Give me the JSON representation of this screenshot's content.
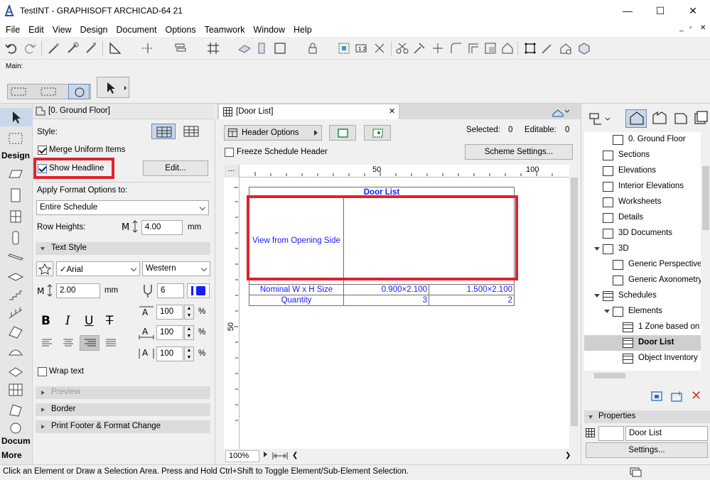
{
  "window": {
    "title": "TestINT - GRAPHISOFT ARCHICAD-64 21",
    "minimize": "—",
    "maximize": "☐",
    "close": "✕"
  },
  "menubar": [
    "File",
    "Edit",
    "View",
    "Design",
    "Document",
    "Options",
    "Teamwork",
    "Window",
    "Help"
  ],
  "mainbar": {
    "label": "Main:"
  },
  "toolbox": {
    "design_tab": "Design",
    "document_tab": "Docum",
    "more_tab": "More"
  },
  "infobox": {
    "header": "[0. Ground Floor]",
    "style_label": "Style:",
    "merge_uniform": "Merge Uniform Items",
    "merge_checked": true,
    "show_headline": "Show Headline",
    "show_headline_checked": true,
    "edit_button": "Edit...",
    "apply_format_label": "Apply Format Options to:",
    "apply_format_value": "Entire Schedule",
    "row_heights_label": "Row Heights:",
    "row_height_value": "4.00",
    "row_height_unit": "mm",
    "text_style_section": "Text Style",
    "font_value": "✓Arial",
    "script_value": "Western",
    "font_size_value": "2.00",
    "font_size_unit": "mm",
    "pen_value": "6",
    "bold": "B",
    "italic": "I",
    "underline": "U",
    "strike": "T",
    "scale1_value": "100",
    "scale2_value": "100",
    "scale3_value": "100",
    "percent": "%",
    "wrap_text": "Wrap text",
    "wrap_checked": false,
    "preview_section": "Preview",
    "border_section": "Border",
    "print_footer_section": "Print Footer & Format Change"
  },
  "document": {
    "tab_title": "[Door List]",
    "header_options": "Header Options",
    "freeze_header": "Freeze Schedule Header",
    "freeze_checked": false,
    "selected_label": "Selected:",
    "selected_value": "0",
    "editable_label": "Editable:",
    "editable_value": "0",
    "scheme_settings": "Scheme Settings...",
    "ruler_marks": [
      "50",
      "100"
    ],
    "ruler_more": "...",
    "vruler_mark": "50",
    "zoom": "100%",
    "schedule": {
      "title": "Door List",
      "headline_row_label": "View from Opening Side",
      "rows": [
        {
          "label": "Nominal W x H Size",
          "values": [
            "0.900×2.100",
            "1.500×2.100"
          ]
        },
        {
          "label": "Quantity",
          "values": [
            "3",
            "2"
          ]
        }
      ]
    }
  },
  "navigator": {
    "items": [
      {
        "label": "0. Ground Floor",
        "indent": 1,
        "icon": "story-icon"
      },
      {
        "label": "Sections",
        "indent": 0,
        "icon": "section-icon"
      },
      {
        "label": "Elevations",
        "indent": 0,
        "icon": "elevation-icon"
      },
      {
        "label": "Interior Elevations",
        "indent": 0,
        "icon": "interior-elevation-icon"
      },
      {
        "label": "Worksheets",
        "indent": 0,
        "icon": "worksheet-icon"
      },
      {
        "label": "Details",
        "indent": 0,
        "icon": "detail-icon"
      },
      {
        "label": "3D Documents",
        "indent": 0,
        "icon": "3d-document-icon"
      },
      {
        "label": "3D",
        "indent": 0,
        "icon": "3d-icon",
        "expander": true
      },
      {
        "label": "Generic Perspective",
        "indent": 1,
        "icon": "perspective-icon"
      },
      {
        "label": "Generic Axonometry",
        "indent": 1,
        "icon": "axonometry-icon"
      },
      {
        "label": "Schedules",
        "indent": 0,
        "icon": "schedule-icon",
        "expander": true
      },
      {
        "label": "Elements",
        "indent": 1,
        "icon": "elements-icon",
        "expander": true
      },
      {
        "label": "1 Zone based on",
        "indent": 2,
        "icon": "schedule-icon"
      },
      {
        "label": "Door List",
        "indent": 2,
        "icon": "schedule-icon",
        "selected": true
      },
      {
        "label": "Object Inventory",
        "indent": 2,
        "icon": "schedule-icon"
      }
    ],
    "properties_label": "Properties",
    "properties_value": "Door List",
    "settings_button": "Settings..."
  },
  "status": "Click an Element or Draw a Selection Area. Press and Hold Ctrl+Shift to Toggle Element/Sub-Element Selection.",
  "colors": {
    "highlight": "#e0212d",
    "schedule_text": "#1a1aff"
  }
}
